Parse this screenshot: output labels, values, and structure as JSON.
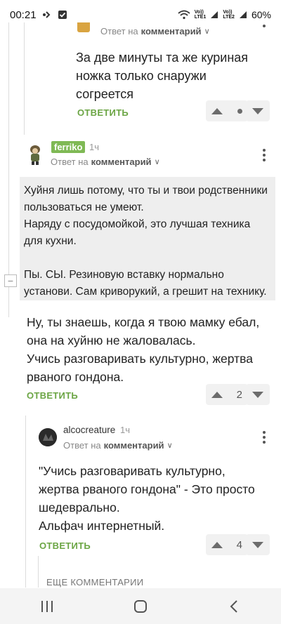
{
  "status": {
    "time": "00:21",
    "network_1": "Vo))\nLTE1",
    "network_2": "Vo))\nLTE2",
    "battery": "60%"
  },
  "comments": {
    "first": {
      "reply_to_prefix": "Ответ на",
      "reply_to_target": "комментарий",
      "text": "За две минуты та же куриная ножка только снаружи согреется",
      "reply_label": "ОТВЕТИТЬ"
    },
    "ferriko": {
      "username": "ferriko",
      "time": "1ч",
      "reply_to_prefix": "Ответ на",
      "reply_to_target": "комментарий",
      "quote_lines": [
        "Хуйня лишь потому, что ты и твои родственники",
        "пользоваться не умеют.",
        "Наряду с посудомойкой, это лучшая техника",
        "для кухни.",
        "",
        "Пы. СЫ. Резиновую вставку нормально",
        "установи. Сам криворукий, а грешит на технику."
      ],
      "text_lines": [
        "Ну, ты знаешь, когда я твою мамку ебал,",
        "она на хуйню не жаловалась.",
        "Учись разговаривать культурно, жертва",
        "рваного гондона."
      ],
      "reply_label": "ОТВЕТИТЬ",
      "votes": "2"
    },
    "alco": {
      "username": "alcocreature",
      "time": "1ч",
      "reply_to_prefix": "Ответ на",
      "reply_to_target": "комментарий",
      "text_lines": [
        "\"Учись разговаривать культурно,",
        "жертва рваного гондона\" - Это просто",
        "шедеврально.",
        "Альфач интернетный."
      ],
      "reply_label": "ОТВЕТИТЬ",
      "votes": "4"
    },
    "more_label": "ЕЩЕ КОММЕНТАРИИ"
  },
  "colors": {
    "accent_green": "#6ba544",
    "badge_green": "#7fb955",
    "quote_bg": "#eeeeee"
  },
  "icons": [
    "signal-icon",
    "check-box-icon",
    "wifi-icon",
    "battery-icon",
    "chevron-down-icon",
    "kebab-menu-icon",
    "upvote-icon",
    "downvote-icon",
    "collapse-icon",
    "recent-apps-icon",
    "home-icon",
    "back-icon"
  ]
}
